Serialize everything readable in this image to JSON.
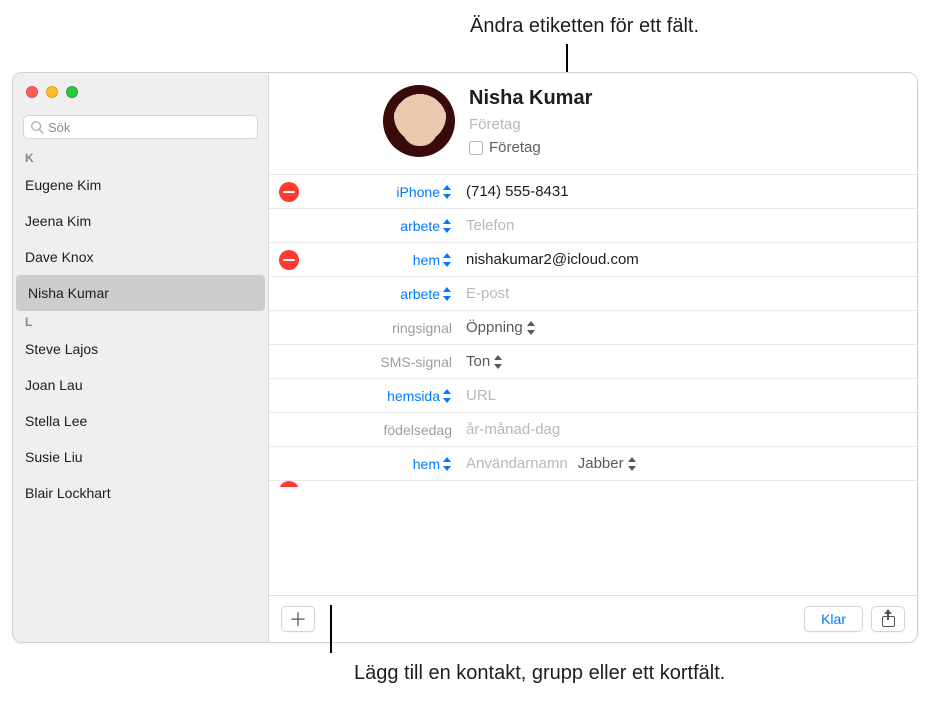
{
  "callouts": {
    "top": "Ändra etiketten för ett fält.",
    "bottom": "Lägg till en kontakt, grupp eller ett kortfält."
  },
  "search": {
    "placeholder": "Sök"
  },
  "sections": {
    "k": "K",
    "l": "L"
  },
  "contacts_k": [
    {
      "name": "Eugene Kim"
    },
    {
      "name": "Jeena Kim"
    },
    {
      "name": "Dave Knox"
    },
    {
      "name": "Nisha Kumar",
      "selected": true
    }
  ],
  "contacts_l": [
    {
      "name": "Steve Lajos"
    },
    {
      "name": "Joan Lau"
    },
    {
      "name": "Stella Lee"
    },
    {
      "name": "Susie Liu"
    },
    {
      "name": "Blair Lockhart"
    }
  ],
  "card": {
    "name": "Nisha  Kumar",
    "company_placeholder": "Företag",
    "company_checkbox_label": "Företag"
  },
  "fields": {
    "phone_iphone_label": "iPhone",
    "phone_iphone_value": "(714) 555-8431",
    "phone_work_label": "arbete",
    "phone_placeholder": "Telefon",
    "email_home_label": "hem",
    "email_home_value": "nishakumar2@icloud.com",
    "email_work_label": "arbete",
    "email_placeholder": "E-post",
    "ringtone_label": "ringsignal",
    "ringtone_value": "Öppning",
    "texttone_label": "SMS-signal",
    "texttone_value": "Ton",
    "homepage_label": "hemsida",
    "homepage_placeholder": "URL",
    "birthday_label": "födelsedag",
    "birthday_placeholder": "år-månad-dag",
    "im_home_label": "hem",
    "im_placeholder": "Användarnamn",
    "im_service": "Jabber"
  },
  "toolbar": {
    "done": "Klar"
  }
}
